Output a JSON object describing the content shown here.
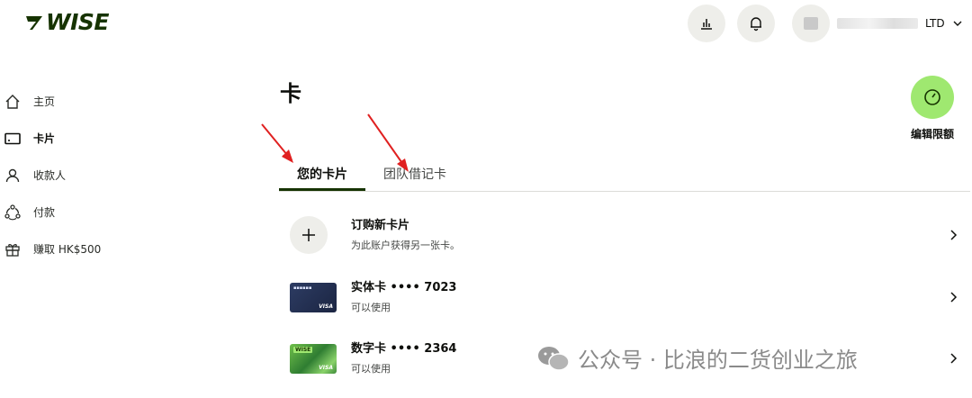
{
  "header": {
    "logo_text": "WISE",
    "account_suffix": "LTD"
  },
  "sidebar": {
    "items": [
      {
        "label": "主页",
        "icon": "home-icon"
      },
      {
        "label": "卡片",
        "icon": "card-icon",
        "active": true
      },
      {
        "label": "收款人",
        "icon": "recipients-icon"
      },
      {
        "label": "付款",
        "icon": "payments-icon"
      },
      {
        "label": "赚取 HK$500",
        "icon": "gift-icon"
      }
    ]
  },
  "main": {
    "title": "卡",
    "limits_label": "编辑限额",
    "tabs": [
      {
        "label": "您的卡片",
        "active": true
      },
      {
        "label": "团队借记卡",
        "active": false
      }
    ],
    "rows": [
      {
        "title": "订购新卡片",
        "subtitle": "为此账户获得另一张卡。",
        "type": "order"
      },
      {
        "title": "实体卡 •••• 7023",
        "subtitle": "可以使用",
        "type": "physical"
      },
      {
        "title": "数字卡 •••• 2364",
        "subtitle": "可以使用",
        "type": "digital"
      }
    ],
    "card_brand": "VISA",
    "digital_card_logo": "WISE"
  },
  "watermark": {
    "text": "公众号 · 比浪的二货创业之旅"
  },
  "colors": {
    "brand_dark": "#163300",
    "brand_green": "#9fe870",
    "annotation_red": "#e02020"
  }
}
